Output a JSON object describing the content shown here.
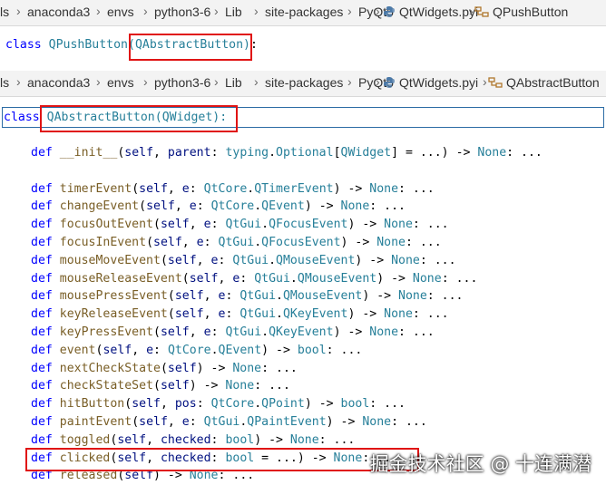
{
  "breadcrumb_top": {
    "items": [
      "ls",
      "anaconda3",
      "envs",
      "python3-6",
      "Lib",
      "site-packages",
      "PyQt5",
      "QtWidgets.pyi",
      "QPushButton"
    ]
  },
  "breadcrumb_second": {
    "items": [
      "ls",
      "anaconda3",
      "envs",
      "python3-6",
      "Lib",
      "site-packages",
      "PyQt5",
      "QtWidgets.pyi",
      "QAbstractButton"
    ]
  },
  "code_top": {
    "keyword": "class",
    "name": "QPushButton",
    "base": "(QAbstractButton)",
    "colon": ":"
  },
  "code_main": {
    "class_keyword": "class",
    "class_decl": "QAbstractButton(QWidget):",
    "lines": [
      "def __init__(self, parent: typing.Optional[QWidget] = ...) -> None: ...",
      "",
      "def timerEvent(self, e: QtCore.QTimerEvent) -> None: ...",
      "def changeEvent(self, e: QtCore.QEvent) -> None: ...",
      "def focusOutEvent(self, e: QtGui.QFocusEvent) -> None: ...",
      "def focusInEvent(self, e: QtGui.QFocusEvent) -> None: ...",
      "def mouseMoveEvent(self, e: QtGui.QMouseEvent) -> None: ...",
      "def mouseReleaseEvent(self, e: QtGui.QMouseEvent) -> None: ...",
      "def mousePressEvent(self, e: QtGui.QMouseEvent) -> None: ...",
      "def keyReleaseEvent(self, e: QtGui.QKeyEvent) -> None: ...",
      "def keyPressEvent(self, e: QtGui.QKeyEvent) -> None: ...",
      "def event(self, e: QtCore.QEvent) -> bool: ...",
      "def nextCheckState(self) -> None: ...",
      "def checkStateSet(self) -> None: ...",
      "def hitButton(self, pos: QtCore.QPoint) -> bool: ...",
      "def paintEvent(self, e: QtGui.QPaintEvent) -> None: ...",
      "def toggled(self, checked: bool) -> None: ...",
      "def clicked(self, checked: bool = ...) -> None: ...",
      "def released(self) -> None: ..."
    ]
  },
  "watermark": "掘金技术社区 @ 十连满潜",
  "colors": {
    "keyword": "#0000ff",
    "function": "#795e26",
    "type": "#267f99",
    "highlight_box": "#e01414"
  }
}
